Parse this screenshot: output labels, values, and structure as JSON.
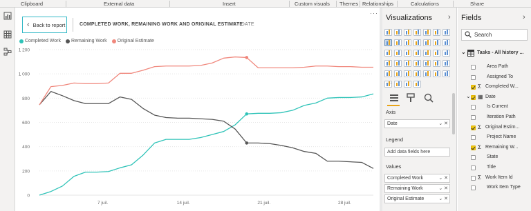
{
  "ribbon": {
    "items": [
      "Clipboard",
      "External data",
      "Insert",
      "Custom visuals",
      "Themes",
      "Relationships",
      "Calculations",
      "Share"
    ]
  },
  "left_nav": [
    "report-view-icon",
    "data-view-icon",
    "relationships-view-icon"
  ],
  "report": {
    "back_label": "Back to report",
    "title": "COMPLETED WORK, REMAINING WORK AND ORIGINAL ESTIMATE",
    "subtitle": "BY DATE",
    "more_label": "···"
  },
  "chart_data": {
    "type": "line",
    "x_label_ticks": [
      "7 juil.",
      "14 juil.",
      "21 juil.",
      "28 juil."
    ],
    "x": [
      1,
      2,
      3,
      4,
      5,
      6,
      7,
      8,
      9,
      10,
      11,
      12,
      13,
      14,
      15,
      16,
      17,
      18,
      19,
      20,
      21,
      22,
      23,
      24,
      25,
      26,
      27,
      28,
      29,
      30
    ],
    "y_ticks": [
      "0",
      "200",
      "400",
      "600",
      "800",
      "1 000",
      "1 200"
    ],
    "ylim": [
      0,
      1200
    ],
    "legend_position": "top-left",
    "grid": true,
    "highlight_index": 18,
    "series": [
      {
        "name": "Completed Work",
        "color": "#2fc3b8",
        "values": [
          0,
          30,
          75,
          155,
          190,
          190,
          195,
          225,
          250,
          330,
          430,
          460,
          460,
          460,
          475,
          500,
          525,
          580,
          670,
          675,
          675,
          680,
          700,
          740,
          760,
          800,
          805,
          805,
          810,
          835
        ]
      },
      {
        "name": "Remaining Work",
        "color": "#555555",
        "values": [
          745,
          855,
          820,
          780,
          755,
          755,
          755,
          810,
          790,
          715,
          660,
          640,
          635,
          635,
          630,
          625,
          610,
          545,
          430,
          430,
          425,
          410,
          390,
          360,
          345,
          280,
          280,
          275,
          270,
          220
        ]
      },
      {
        "name": "Original Estimate",
        "color": "#f0877c",
        "values": [
          745,
          895,
          905,
          925,
          920,
          920,
          925,
          1005,
          1005,
          1030,
          1060,
          1065,
          1065,
          1065,
          1070,
          1090,
          1130,
          1140,
          1135,
          1050,
          1050,
          1050,
          1050,
          1055,
          1065,
          1065,
          1060,
          1060,
          1055,
          1055
        ]
      }
    ]
  },
  "visualizations": {
    "title": "Visualizations",
    "tabs": [
      "fields-tab-icon",
      "format-paint-icon",
      "analytics-icon"
    ],
    "axis_label": "Axis",
    "axis_value": "Date",
    "legend_label": "Legend",
    "legend_placeholder": "Add data fields here",
    "values_label": "Values",
    "values": [
      "Completed Work",
      "Remaining Work",
      "Original Estimate"
    ],
    "more": "···"
  },
  "fields": {
    "title": "Fields",
    "search_placeholder": "Search",
    "table_name": "Tasks - All history ...",
    "items": [
      {
        "label": "Area Path",
        "checked": false,
        "sigma": false
      },
      {
        "label": "Assigned To",
        "checked": false,
        "sigma": false
      },
      {
        "label": "Completed W...",
        "checked": true,
        "sigma": true
      },
      {
        "label": "Date",
        "checked": true,
        "sigma": false,
        "expand": true
      },
      {
        "label": "Is Current",
        "checked": false,
        "sigma": false
      },
      {
        "label": "Iteration Path",
        "checked": false,
        "sigma": false
      },
      {
        "label": "Original Estim...",
        "checked": true,
        "sigma": true
      },
      {
        "label": "Project Name",
        "checked": false,
        "sigma": false
      },
      {
        "label": "Remaining W...",
        "checked": true,
        "sigma": true
      },
      {
        "label": "State",
        "checked": false,
        "sigma": false
      },
      {
        "label": "Title",
        "checked": false,
        "sigma": false
      },
      {
        "label": "Work Item Id",
        "checked": false,
        "sigma": true
      },
      {
        "label": "Work Item Type",
        "checked": false,
        "sigma": false
      }
    ]
  }
}
